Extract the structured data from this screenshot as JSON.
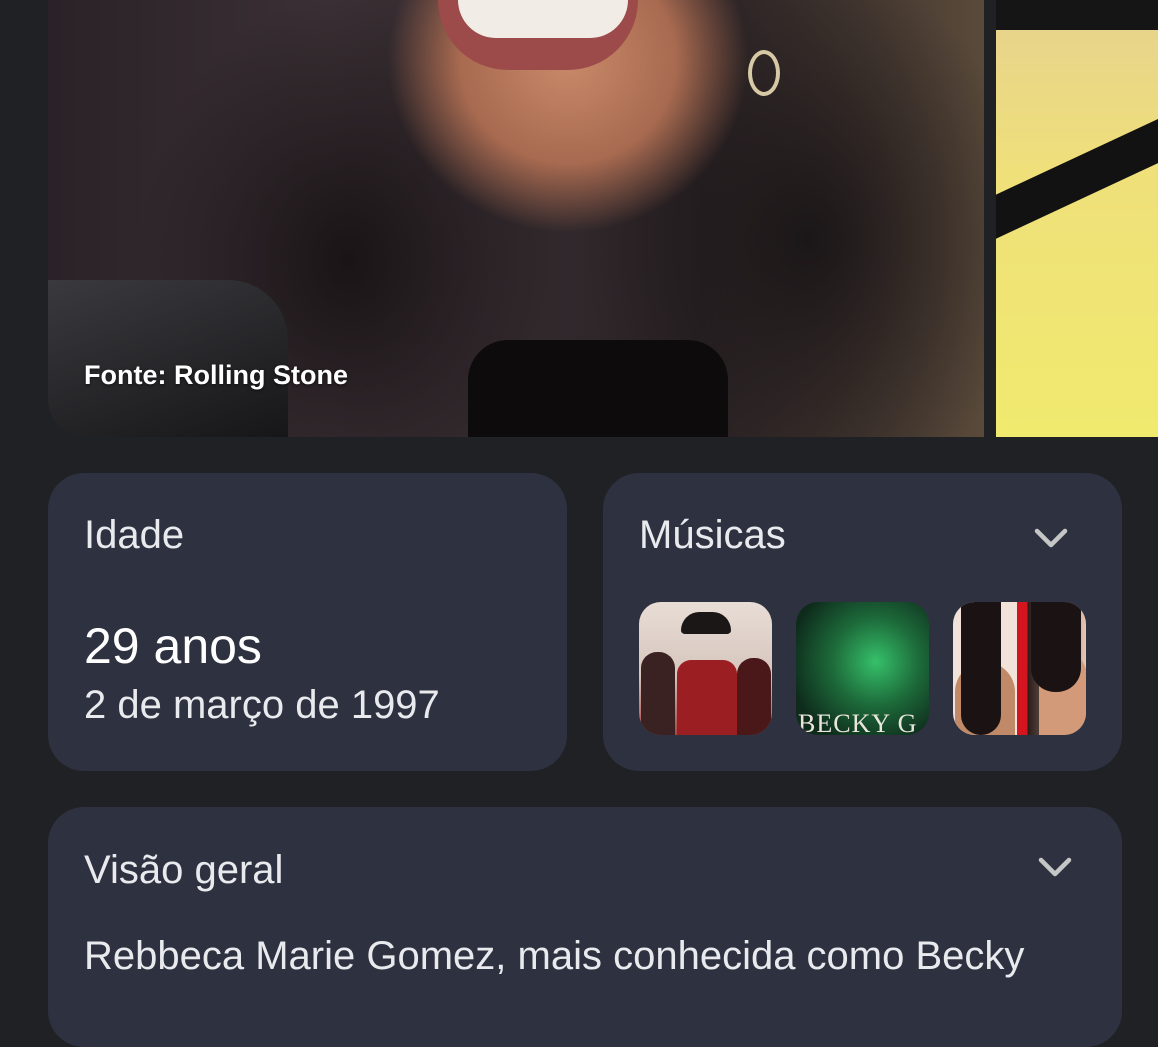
{
  "hero": {
    "caption": "Fonte: Rolling Stone"
  },
  "age_card": {
    "title": "Idade",
    "value": "29 anos",
    "date": "2 de março de 1997"
  },
  "songs_card": {
    "title": "Músicas",
    "expand_icon": "chevron-down-icon",
    "thumbnails": [
      {
        "name": "song-thumbnail-1"
      },
      {
        "name": "song-thumbnail-2",
        "text": "BECKY G"
      },
      {
        "name": "song-thumbnail-3"
      }
    ]
  },
  "overview_card": {
    "title": "Visão geral",
    "expand_icon": "chevron-down-icon",
    "text": "Rebbeca Marie Gomez, mais conhecida como Becky"
  },
  "colors": {
    "background": "#202124",
    "card": "#2e3140",
    "text": "#e8eaed"
  }
}
